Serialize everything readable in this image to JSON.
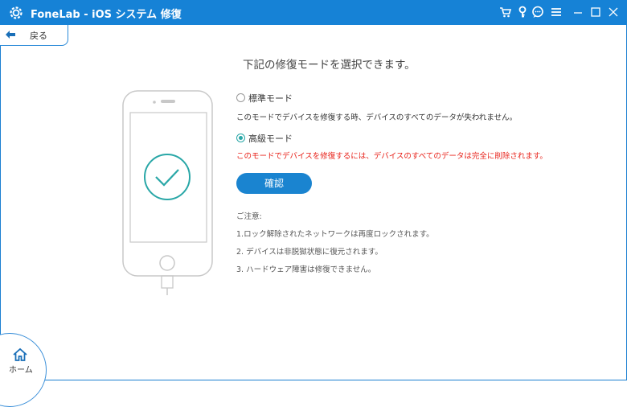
{
  "app": {
    "title": "FoneLab - iOS システム 修復",
    "brand_color": "#1682d6"
  },
  "toolbar": {
    "icons": [
      "cart-icon",
      "key-icon",
      "chat-icon",
      "menu-icon"
    ],
    "window_controls": [
      "minimize-icon",
      "maximize-icon",
      "close-icon"
    ]
  },
  "nav": {
    "back_label": "戻る",
    "home_label": "ホーム"
  },
  "main": {
    "heading": "下記の修復モードを選択できます。",
    "options": [
      {
        "label": "標準モード",
        "selected": false,
        "description": "このモードでデバイスを修復する時、デバイスのすべてのデータが失われません。"
      },
      {
        "label": "高級モード",
        "selected": true,
        "description": "このモードでデバイスを修復するには、デバイスのすべてのデータは完全に削除されます。"
      }
    ],
    "confirm_label": "確認",
    "notes_title": "ご注意:",
    "notes": [
      "1.ロック解除されたネットワークは再度ロックされます。",
      "2. デバイスは非脱獄状態に復元されます。",
      "3. ハードウェア障害は修復できません。"
    ],
    "warning_color": "#e8231b",
    "accent_teal": "#29a7a7"
  }
}
